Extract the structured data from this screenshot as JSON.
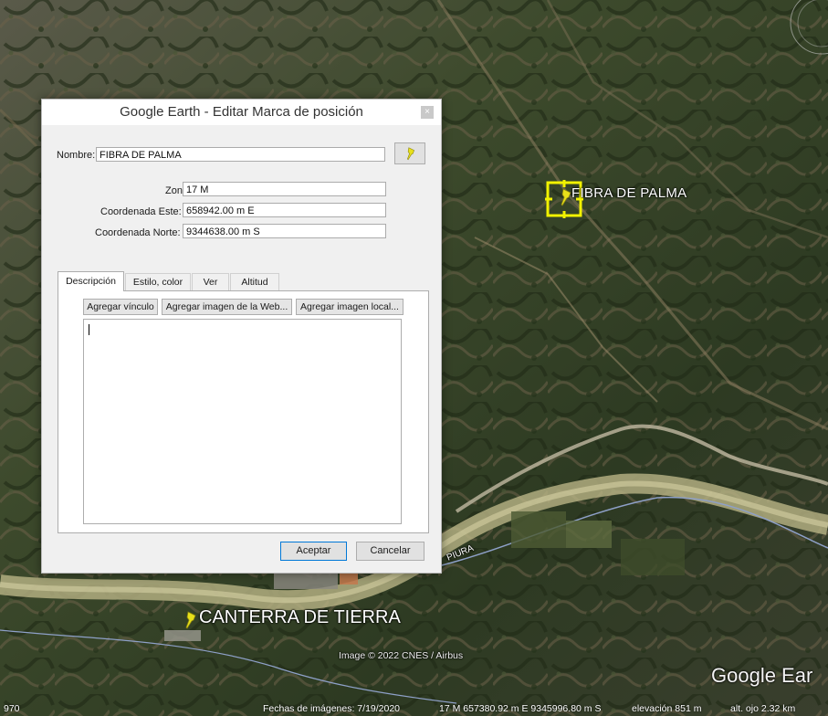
{
  "map": {
    "placemark_main": "FIBRA DE PALMA",
    "placemark_secondary": "CANTERRA DE TIERRA",
    "river_label": "PIURA",
    "copyright": "Image © 2022 CNES / Airbus",
    "brand": "Google Ear",
    "status": {
      "left_value": "970",
      "imagery_date": "Fechas de imágenes: 7/19/2020",
      "coords": "17 M 657380.92 m E 9345996.80 m S",
      "elevation": "elevación 851 m",
      "eye_alt": "alt. ojo 2.32 km"
    }
  },
  "dialog": {
    "title": "Google Earth - Editar Marca de posición",
    "close": "×",
    "name_label": "Nombre:",
    "name_value": "FIBRA DE PALMA",
    "zone_label": "Zona:",
    "zone_value": "17 M",
    "east_label": "Coordenada Este:",
    "east_value": "658942.00 m E",
    "north_label": "Coordenada Norte:",
    "north_value": "9344638.00 m S",
    "tabs": [
      "Descripción",
      "Estilo, color",
      "Ver",
      "Altitud"
    ],
    "add_link": "Agregar vínculo",
    "add_web_image": "Agregar imagen de la Web...",
    "add_local_image": "Agregar imagen local...",
    "ok": "Aceptar",
    "cancel": "Cancelar"
  },
  "colors": {
    "pin_yellow": "#e8e01a",
    "selection_yellow": "#f2f200",
    "ok_border": "#0078d7"
  }
}
